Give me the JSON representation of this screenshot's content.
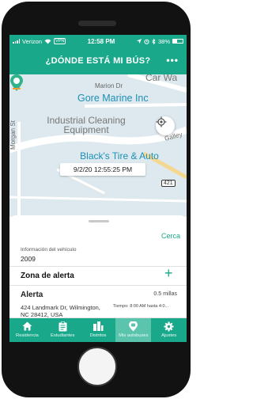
{
  "status_bar": {
    "carrier": "Verizon",
    "vpn": "VPN",
    "time": "12:58 PM",
    "battery": "38%",
    "battery_level": 0.38
  },
  "header": {
    "title": "¿DÓNDE ESTÁ MI BÚS?",
    "more_icon": "more-dots-icon"
  },
  "map": {
    "streets": [
      "Car Wa",
      "Marion Dr",
      "Morgan St",
      "Galley"
    ],
    "places": [
      "Gore Marine Inc",
      "Industrial Cleaning Equipment",
      "Black's Tire & Auto Service"
    ],
    "route_shield": "421",
    "bus_timestamp": "9/2/20 12:55:25 PM",
    "locate_icon": "crosshair-icon",
    "bus_icon": "bus-marker-icon"
  },
  "sheet": {
    "close_label": "Cerca",
    "vehicle_info_label": "Información del vehículo",
    "vehicle_year": "2009",
    "alert_zone_label": "Zona de alerta",
    "add_label": "+",
    "alert": {
      "title": "Alerta",
      "distance": "0.5 millas",
      "address_line1": "424 Landmark Dr, Wilmington,",
      "address_line2": "NC 28412, USA",
      "time": "Tiempo: 8:00 AM hasta 4:0..."
    }
  },
  "tabs": [
    {
      "label": "Residencia",
      "icon": "home-icon",
      "active": false
    },
    {
      "label": "Estudiantes",
      "icon": "students-icon",
      "active": false
    },
    {
      "label": "Distritos",
      "icon": "districts-icon",
      "active": false
    },
    {
      "label": "Mis autobuses",
      "icon": "bus-icon",
      "active": true
    },
    {
      "label": "Ajustes",
      "icon": "gear-icon",
      "active": false
    }
  ],
  "colors": {
    "accent": "#1aa88b",
    "active_tab": "#5bc4ad",
    "map_water": "#dde9ee",
    "place_text": "#1c8fb6"
  }
}
